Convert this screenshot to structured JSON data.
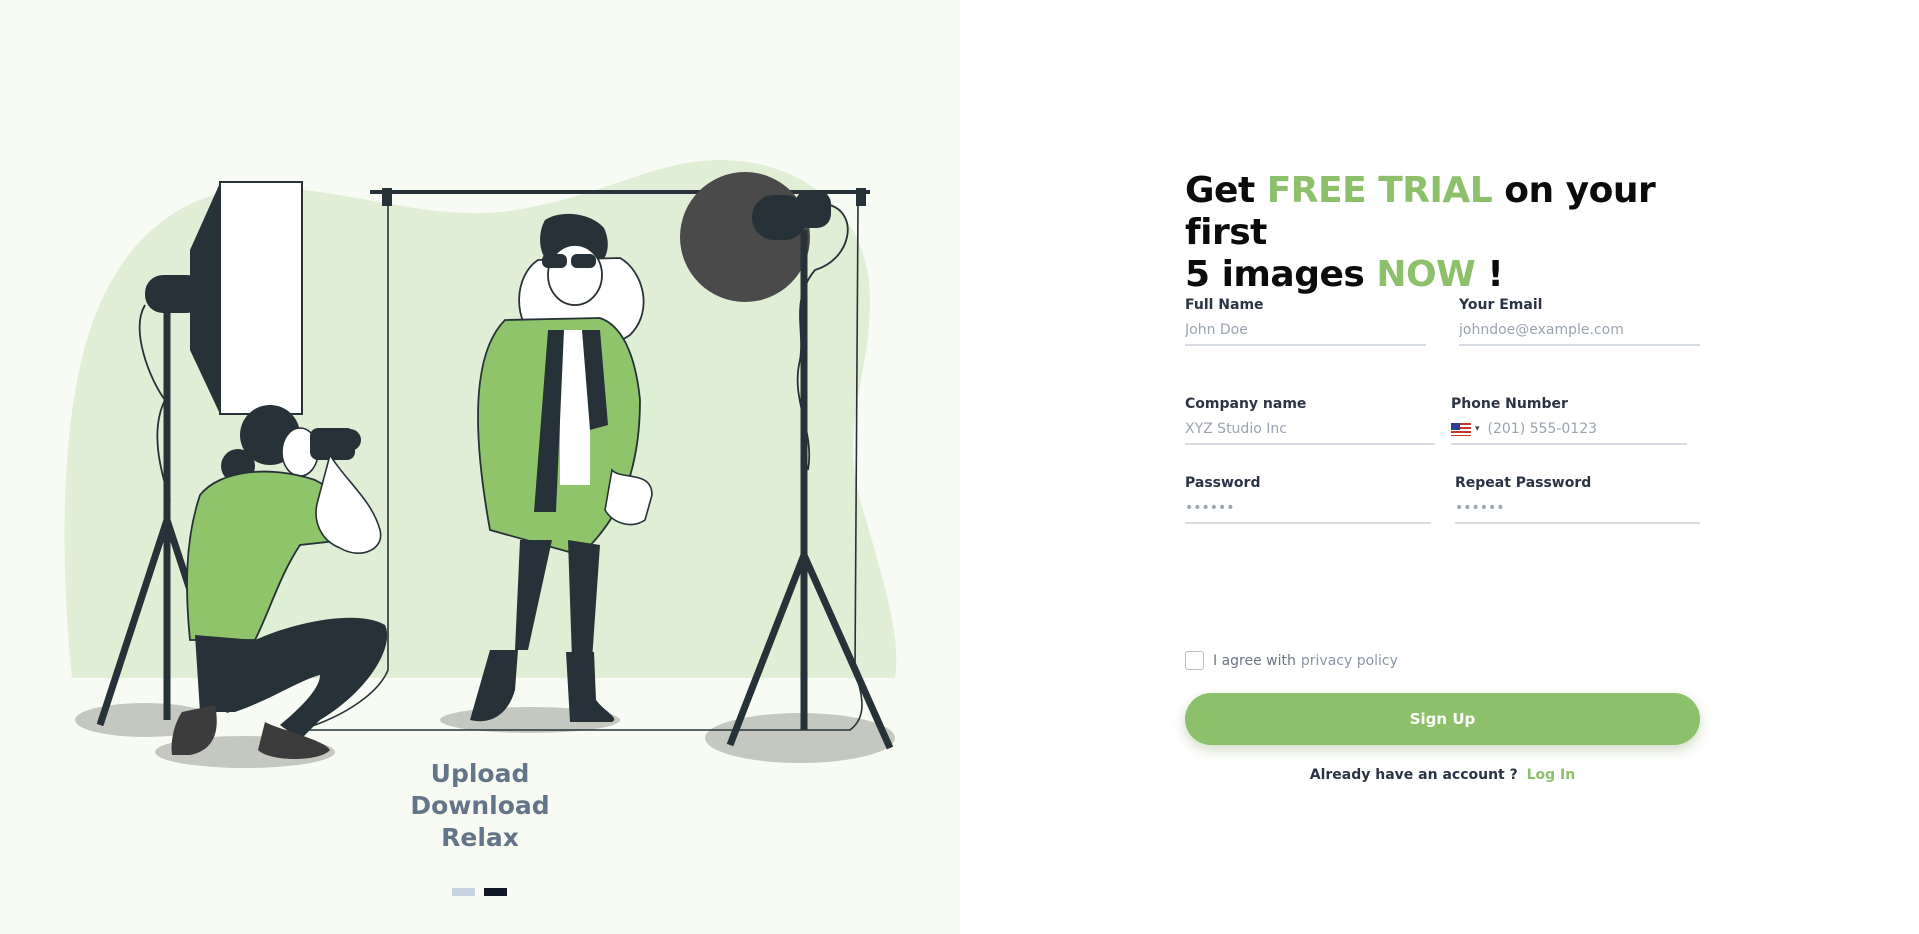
{
  "left": {
    "tagline": [
      "Upload",
      "Download",
      "Relax"
    ],
    "carousel_active_index": 1,
    "carousel_count": 2
  },
  "form": {
    "headline": {
      "part1": "Get ",
      "accent1": "FREE TRIAL",
      "part2": " on your first",
      "part3": "5 images ",
      "accent2": "NOW",
      "part4": " !"
    },
    "full_name": {
      "label": "Full Name",
      "placeholder": "John Doe"
    },
    "email": {
      "label": "Your Email",
      "placeholder": "johndoe@example.com"
    },
    "company": {
      "label": "Company name",
      "placeholder": "XYZ Studio Inc"
    },
    "phone": {
      "label": "Phone Number",
      "placeholder": "(201) 555-0123",
      "country_flag": "us-flag-icon",
      "caret": "▾"
    },
    "password": {
      "label": "Password",
      "placeholder": "••••••"
    },
    "repeat_password": {
      "label": "Repeat Password",
      "placeholder": "••••••"
    },
    "agree": {
      "prefix": "I agree with",
      "link": "privacy policy"
    },
    "signup_label": "Sign Up",
    "login_prompt": "Already have an account ?",
    "login_link": "Log In"
  },
  "colors": {
    "accent": "#8dc06a",
    "left_bg": "#f7fbf3",
    "tagline": "#647589",
    "dark": "#263238"
  }
}
